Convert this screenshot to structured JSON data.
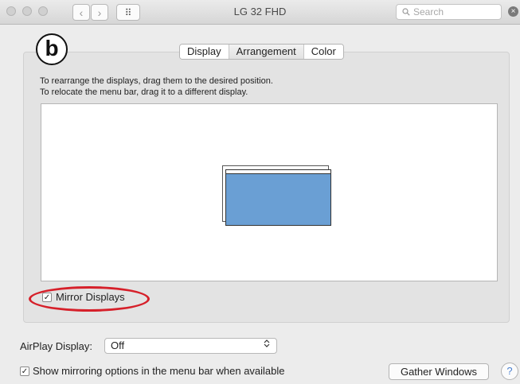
{
  "window": {
    "title": "LG 32 FHD"
  },
  "toolbar": {
    "back_glyph": "‹",
    "forward_glyph": "›",
    "grid_glyph": "⠿",
    "search_placeholder": "Search",
    "search_value": "",
    "clear_glyph": "×"
  },
  "badge": {
    "label": "b"
  },
  "tabs": [
    {
      "label": "Display",
      "selected": false
    },
    {
      "label": "Arrangement",
      "selected": true
    },
    {
      "label": "Color",
      "selected": false
    }
  ],
  "instructions": {
    "line1": "To rearrange the displays, drag them to the desired position.",
    "line2": "To relocate the menu bar, drag it to a different display."
  },
  "mirror": {
    "label": "Mirror Displays",
    "checked": true,
    "check_glyph": "✓"
  },
  "airplay": {
    "label": "AirPlay Display:",
    "value": "Off",
    "arrows_glyph": "⌃⌄"
  },
  "show_mirroring": {
    "label": "Show mirroring options in the menu bar when available",
    "checked": true,
    "check_glyph": "✓"
  },
  "buttons": {
    "gather": "Gather Windows",
    "help": "?"
  },
  "colors": {
    "display_fill": "#6a9fd4",
    "highlight_oval": "#d6202a",
    "help_accent": "#4a7fd0"
  }
}
